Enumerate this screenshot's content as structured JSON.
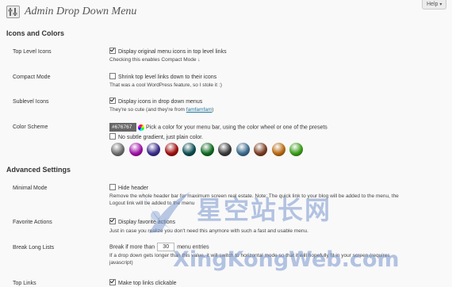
{
  "header": {
    "title": "Admin Drop Down Menu",
    "help_label": "Help",
    "help_arrow": "▾"
  },
  "sections": {
    "icons_colors": "Icons and Colors",
    "advanced": "Advanced Settings"
  },
  "top_level_icons": {
    "label": "Top Level Icons",
    "option": "Display original menu icons in top level links",
    "checked": true,
    "desc": "Checking this enables Compact Mode ↓"
  },
  "compact_mode": {
    "label": "Compact Mode",
    "option": "Shrink top level links down to their icons",
    "checked": false,
    "desc": "That was a cool WordPress feature, so I stole it :)"
  },
  "sublevel_icons": {
    "label": "Sublevel Icons",
    "option": "Display icons in drop down menus",
    "checked": true,
    "desc_prefix": "They're so cute (and they're from ",
    "desc_link": "famfamfam",
    "desc_suffix": ")"
  },
  "color_scheme": {
    "label": "Color Scheme",
    "value": "#676767",
    "hint": "Pick a color for your menu bar, using the color wheel or one of the presets",
    "gradient_option": "No subtle gradient, just plain color.",
    "gradient_checked": false,
    "swatches": [
      "#6d6d6d",
      "#a012a8",
      "#3a2d8c",
      "#a01010",
      "#0c4e52",
      "#0f6b22",
      "#3a3a3a",
      "#3b6b8e",
      "#7a3e22",
      "#b86a12",
      "#3a9d18"
    ]
  },
  "minimal_mode": {
    "label": "Minimal Mode",
    "option": "Hide header",
    "checked": false,
    "desc": "Remove the whole header bar for maximum screen real estate. Note: The quick link to your blog will be added to the menu, the",
    "desc2": "Logout link will be added to the menu"
  },
  "favorite_actions": {
    "label": "Favorite Actions",
    "option": "Display favorite actions",
    "checked": true,
    "desc": "Just in case you realize you don't need this anymore with such a fast and usable menu."
  },
  "break_long_lists": {
    "label": "Break Long Lists",
    "prefix": "Break if more than",
    "value": "30",
    "suffix": "menu entries",
    "desc": "If a drop down gets longer than this value, it will switch to horizontal mode so that it will hopefully fit in your screen (requires",
    "desc2": "javascript)"
  },
  "top_links": {
    "label": "Top Links",
    "option": "Make top links clickable",
    "checked": true
  },
  "watermark": {
    "cn": "星空站长网",
    "en": "XingKongWeb.com"
  }
}
